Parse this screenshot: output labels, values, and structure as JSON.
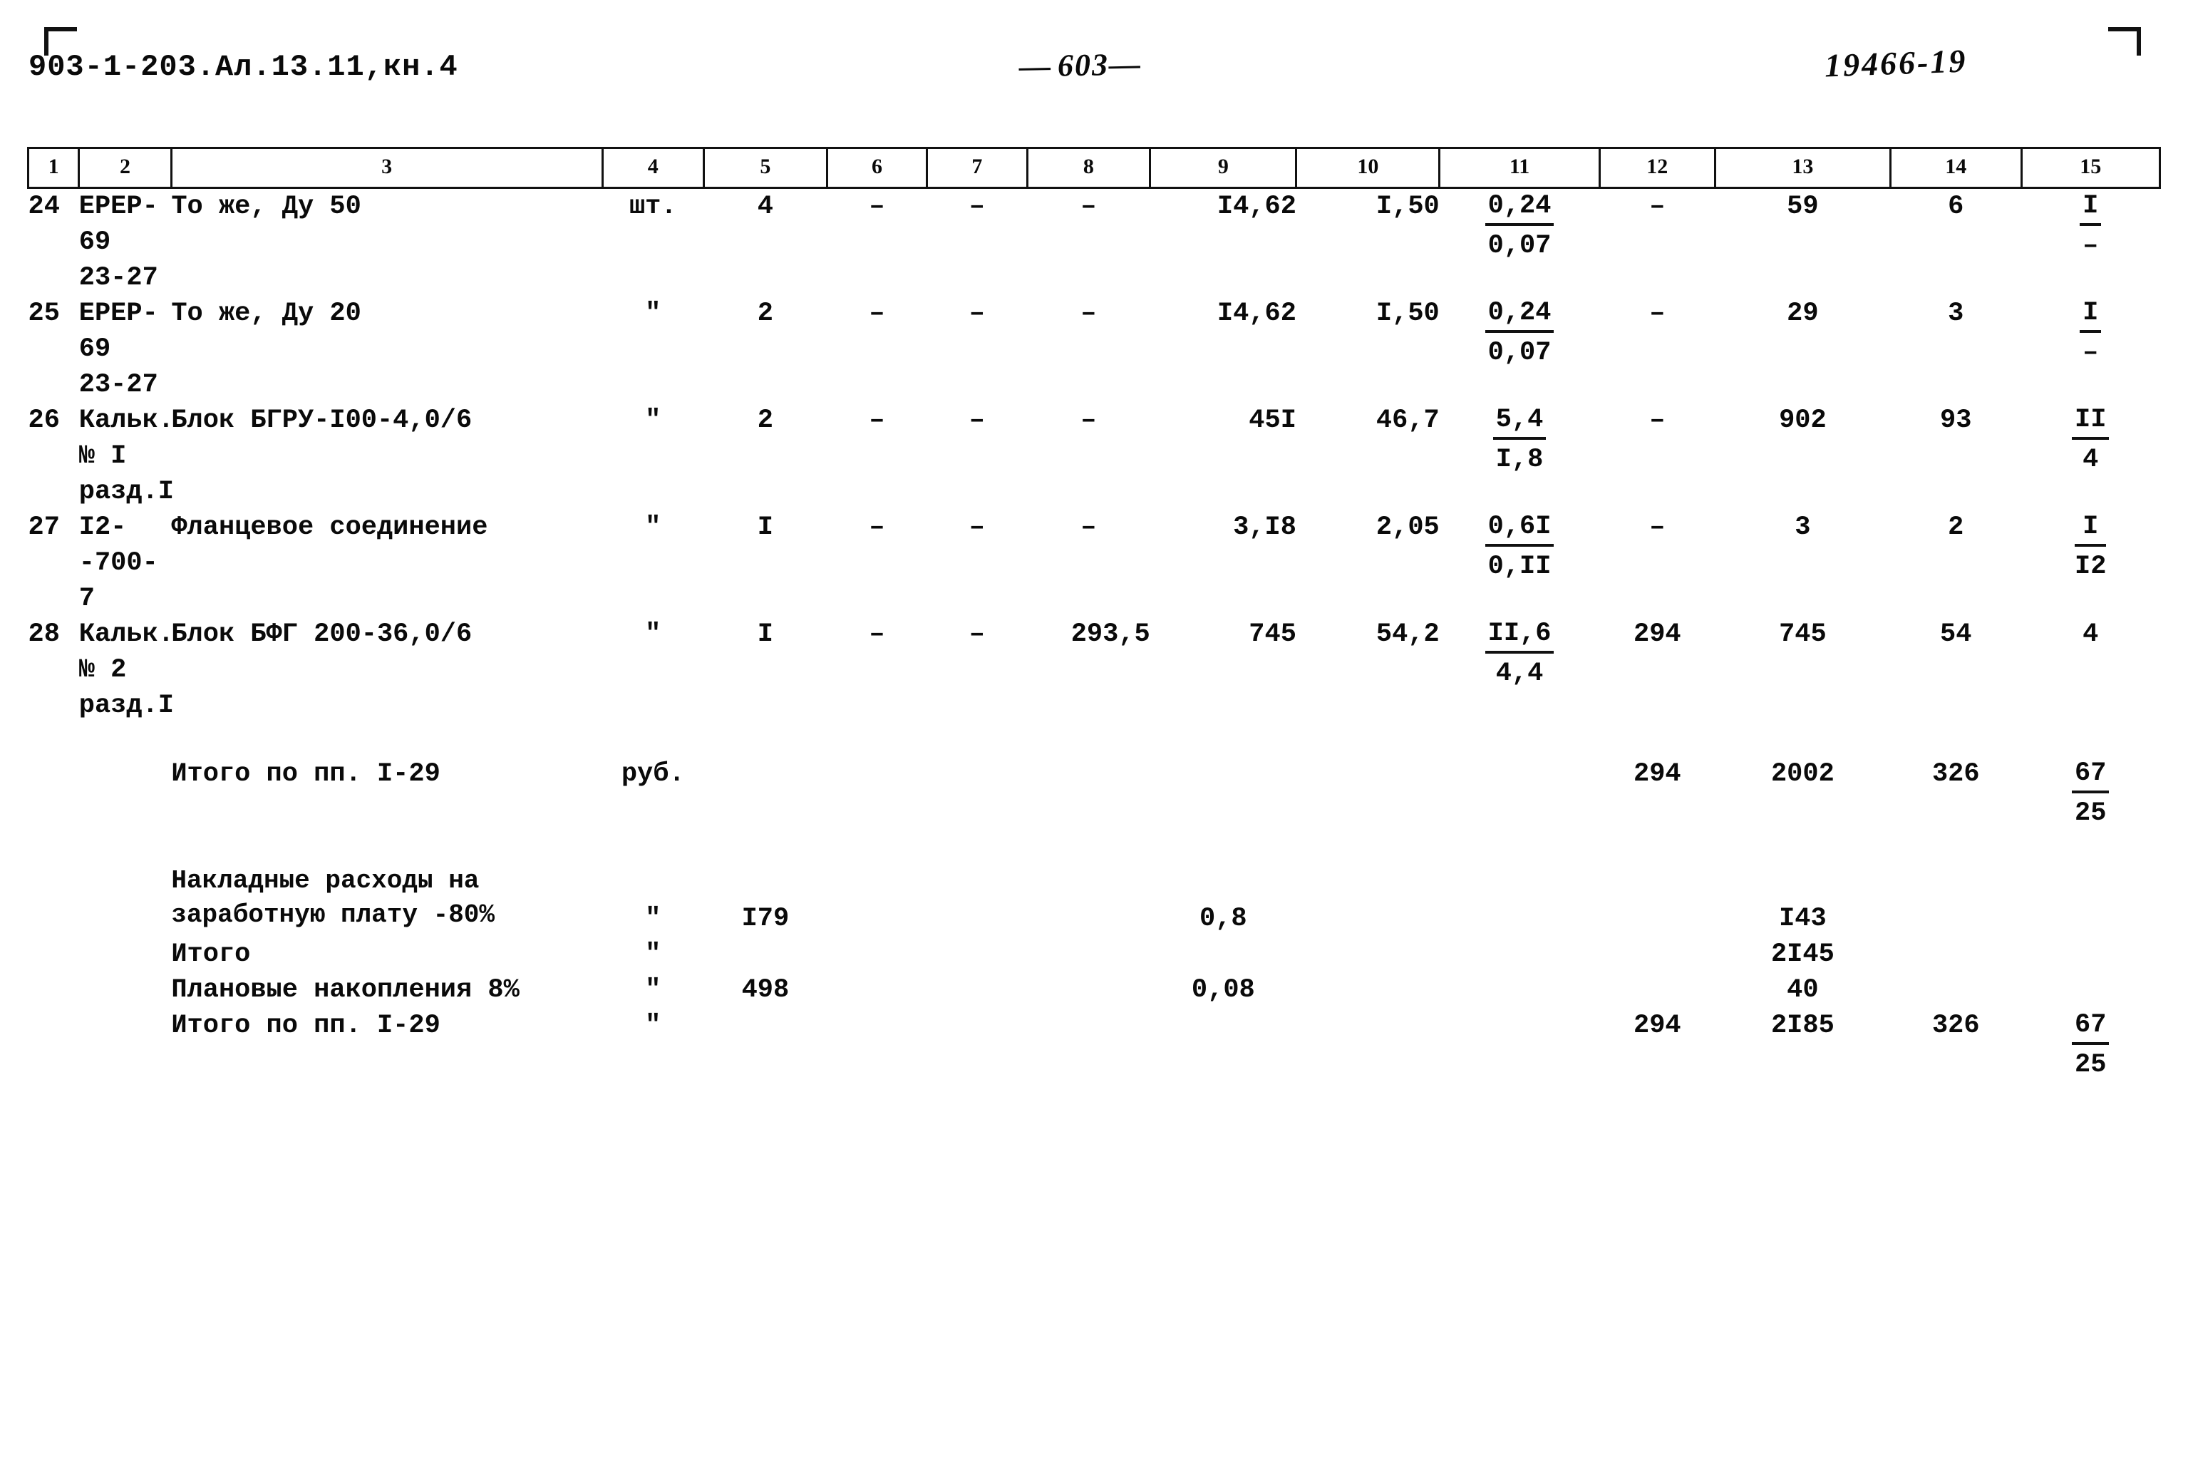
{
  "header": {
    "doc_code": "903-1-203.Ал.13.11,кн.4",
    "page_number": "603",
    "stamp_number": "19466-19"
  },
  "table": {
    "column_headers": [
      "1",
      "2",
      "3",
      "4",
      "5",
      "6",
      "7",
      "8",
      "9",
      "10",
      "11",
      "12",
      "13",
      "14",
      "15"
    ],
    "rows": [
      {
        "num": "24",
        "code": "ЕРЕР-\n69\n23-27",
        "name": "То же, Ду 50",
        "unit": "шт.",
        "c5": "4",
        "c6": "–",
        "c7": "–",
        "c8": "–",
        "c9": "I4,62",
        "c10": "I,50",
        "c11_top": "0,24",
        "c11_bot": "0,07",
        "c12": "–",
        "c13": "59",
        "c14": "6",
        "c15_top": "I",
        "c15_bot": "–"
      },
      {
        "num": "25",
        "code": "ЕРЕР-\n69\n23-27",
        "name": "То же, Ду 20",
        "unit": "\"",
        "c5": "2",
        "c6": "–",
        "c7": "–",
        "c8": "–",
        "c9": "I4,62",
        "c10": "I,50",
        "c11_top": "0,24",
        "c11_bot": "0,07",
        "c12": "–",
        "c13": "29",
        "c14": "3",
        "c15_top": "I",
        "c15_bot": "–"
      },
      {
        "num": "26",
        "code": "Кальк.\n№ I\nразд.I",
        "name": "Блок БГРУ-I00-4,0/6",
        "unit": "\"",
        "c5": "2",
        "c6": "–",
        "c7": "–",
        "c8": "–",
        "c9": "45I",
        "c10": "46,7",
        "c11_top": "5,4",
        "c11_bot": "I,8",
        "c12": "–",
        "c13": "902",
        "c14": "93",
        "c15_top": "II",
        "c15_bot": "4"
      },
      {
        "num": "27",
        "code": "I2-\n-700-\n7",
        "name": "Фланцевое соединение",
        "unit": "\"",
        "c5": "I",
        "c6": "–",
        "c7": "–",
        "c8": "–",
        "c9": "3,I8",
        "c10": "2,05",
        "c11_top": "0,6I",
        "c11_bot": "0,II",
        "c12": "–",
        "c13": "3",
        "c14": "2",
        "c15_top": "I",
        "c15_bot": "I2"
      },
      {
        "num": "28",
        "code": "Кальк.\n№ 2\nразд.I",
        "name": "Блок БФГ 200-36,0/6",
        "unit": "\"",
        "c5": "I",
        "c6": "–",
        "c7": "–",
        "c8": "293,5",
        "c9": "745",
        "c10": "54,2",
        "c11_top": "II,6",
        "c11_bot": "4,4",
        "c12": "294",
        "c13": "745",
        "c14": "54",
        "c15_top": "4",
        "c15_bot": ""
      }
    ],
    "summary_rows": [
      {
        "name": "Итого по пп. I-29",
        "unit": "руб.",
        "c5": "",
        "c9": "",
        "c12": "294",
        "c13": "2002",
        "c14": "326",
        "c15_top": "67",
        "c15_bot": "25"
      },
      {
        "name": "Накладные расходы  на\nзаработную плату -80%",
        "unit": "\"",
        "c5": "I79",
        "c9": "0,8",
        "c12": "",
        "c13": "I43",
        "c14": "",
        "c15_top": "",
        "c15_bot": ""
      },
      {
        "name": "Итого",
        "unit": "\"",
        "c5": "",
        "c9": "",
        "c12": "",
        "c13": "2I45",
        "c14": "",
        "c15_top": "",
        "c15_bot": ""
      },
      {
        "name": "Плановые накопления 8%",
        "unit": "\"",
        "c5": "498",
        "c9": "0,08",
        "c12": "",
        "c13": "40",
        "c14": "",
        "c15_top": "",
        "c15_bot": ""
      },
      {
        "name": "Итого по пп. I-29",
        "unit": "\"",
        "c5": "",
        "c9": "",
        "c12": "294",
        "c13": "2I85",
        "c14": "326",
        "c15_top": "67",
        "c15_bot": "25"
      }
    ]
  }
}
